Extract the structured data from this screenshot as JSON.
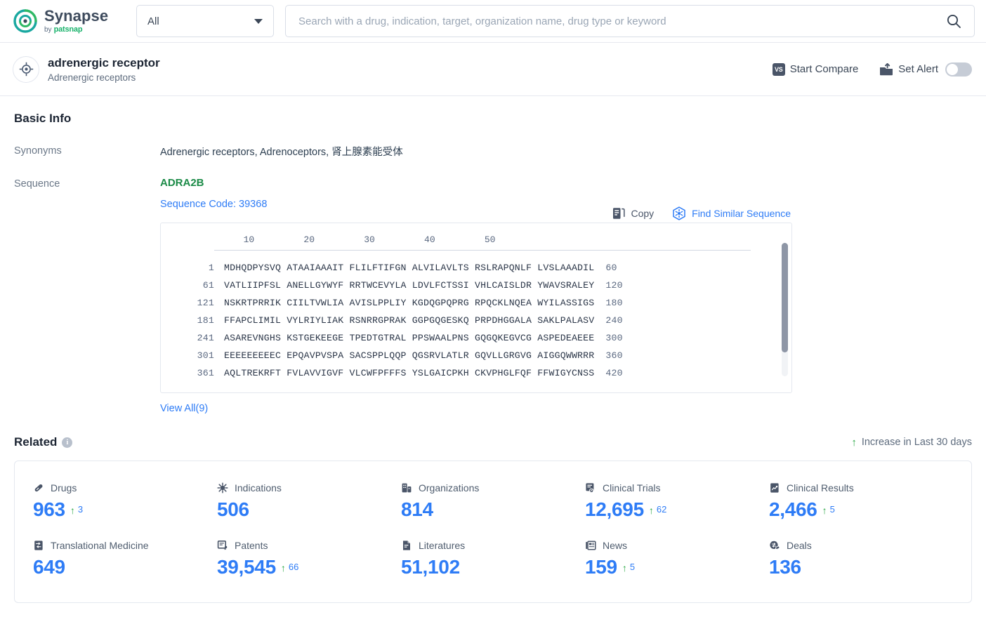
{
  "brand": {
    "name": "Synapse",
    "by": "by",
    "company": "patsnap"
  },
  "search": {
    "scope_label": "All",
    "placeholder": "Search with a drug, indication, target, organization name, drug type or keyword",
    "value": "",
    "search_icon": "search-icon",
    "caret_icon": "chevron-down-icon"
  },
  "entity": {
    "icon": "target-icon",
    "title": "adrenergic receptor",
    "subtitle": "Adrenergic receptors",
    "actions": {
      "compare_label": "Start Compare",
      "compare_badge": "VS",
      "alert_label": "Set Alert",
      "alert_icon": "alert-upload-icon",
      "alert_toggle_state": "off"
    }
  },
  "basic_info": {
    "title": "Basic Info",
    "synonyms_label": "Synonyms",
    "synonyms_value": "Adrenergic receptors,  Adrenoceptors,  肾上腺素能受体",
    "sequence_label": "Sequence",
    "sequence_name": "ADRA2B",
    "sequence_code": "Sequence Code: 39368",
    "copy_label": "Copy",
    "copy_icon": "copy-icon",
    "find_similar_label": "Find Similar Sequence",
    "find_similar_icon": "find-similar-icon",
    "view_all_label": "View All(9)",
    "ruler_ticks": [
      "10",
      "20",
      "30",
      "40",
      "50"
    ],
    "rows": [
      {
        "start": "1",
        "chunks": "MDHQDPYSVQ ATAAIAAAIT FLILFTIFGN ALVILAVLTS RSLRAPQNLF LVSLAAADIL",
        "end": "60"
      },
      {
        "start": "61",
        "chunks": "VATLIIPFSL ANELLGYWYF RRTWCEVYLA LDVLFCTSSI VHLCAISLDR YWAVSRALEY",
        "end": "120"
      },
      {
        "start": "121",
        "chunks": "NSKRTPRRIK CIILTVWLIA AVISLPPLIY KGDQGPQPRG RPQCKLNQEA WYILASSIGS",
        "end": "180"
      },
      {
        "start": "181",
        "chunks": "FFAPCLIMIL VYLRIYLIAK RSNRRGPRAK GGPGQGESKQ PRPDHGGALA SAKLPALASV",
        "end": "240"
      },
      {
        "start": "241",
        "chunks": "ASAREVNGHS KSTGEKEEGE TPEDTGTRAL PPSWAALPNS GQGQKEGVCG ASPEDEAEEE",
        "end": "300"
      },
      {
        "start": "301",
        "chunks": "EEEEEEEEEC EPQAVPVSPA SACSPPLQQP QGSRVLATLR GQVLLGRGVG AIGGQWWRRR",
        "end": "360"
      },
      {
        "start": "361",
        "chunks": "AQLTREKRFT FVLAVVIGVF VLCWFPFFFS YSLGAICPKH CKVPHGLFQF FFWIGYCNSS",
        "end": "420"
      }
    ]
  },
  "related": {
    "title": "Related",
    "info_icon": "info-icon",
    "legend_label": "Increase in Last 30 days",
    "legend_arrow_icon": "up-arrow-icon",
    "stats": [
      {
        "icon": "pill-icon",
        "label": "Drugs",
        "value": "963",
        "delta": "3"
      },
      {
        "icon": "virus-icon",
        "label": "Indications",
        "value": "506",
        "delta": ""
      },
      {
        "icon": "building-icon",
        "label": "Organizations",
        "value": "814",
        "delta": ""
      },
      {
        "icon": "clinical-trial-icon",
        "label": "Clinical Trials",
        "value": "12,695",
        "delta": "62"
      },
      {
        "icon": "clinical-result-icon",
        "label": "Clinical Results",
        "value": "2,466",
        "delta": "5"
      },
      {
        "icon": "translational-medicine-icon",
        "label": "Translational Medicine",
        "value": "649",
        "delta": ""
      },
      {
        "icon": "patent-icon",
        "label": "Patents",
        "value": "39,545",
        "delta": "66"
      },
      {
        "icon": "literature-icon",
        "label": "Literatures",
        "value": "51,102",
        "delta": ""
      },
      {
        "icon": "news-icon",
        "label": "News",
        "value": "159",
        "delta": "5"
      },
      {
        "icon": "deal-icon",
        "label": "Deals",
        "value": "136",
        "delta": ""
      }
    ]
  }
}
